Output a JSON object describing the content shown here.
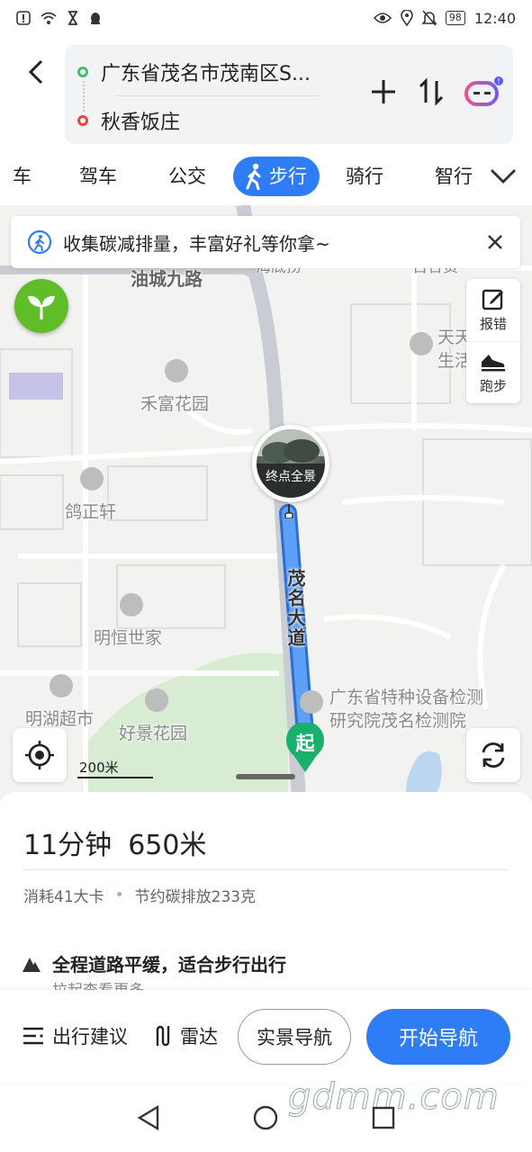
{
  "status_bar": {
    "time": "12:40",
    "battery": "98"
  },
  "route": {
    "origin": "广东省茂名市茂南区S...",
    "destination": "秋香饭庄"
  },
  "tabs": [
    {
      "label": "车"
    },
    {
      "label": "驾车"
    },
    {
      "label": "公交"
    },
    {
      "label": "步行",
      "active": true
    },
    {
      "label": "骑行"
    },
    {
      "label": "智行"
    }
  ],
  "banner": {
    "text": "收集碳减排量，丰富好礼等你拿~"
  },
  "side_tools": {
    "report_label": "报错",
    "run_label": "跑步"
  },
  "map": {
    "labels": {
      "road_top": "油城九路",
      "hefu": "禾富花园",
      "gezheng": "鸽正轩",
      "mingheng": "明恒世家",
      "minghu": "明湖超市",
      "haojing": "好景花园",
      "tianyi_1": "天天",
      "tianyi_2": "生活",
      "main_road": "茂名大道",
      "institute_1": "广东省特种设备检测",
      "institute_2": "研究院茂名检测院",
      "top_fragment_left": "海底捞",
      "top_fragment_right": "百合货"
    },
    "pano_label": "终点全景",
    "start_label": "起",
    "scale": "200米"
  },
  "summary": {
    "duration": "11分钟",
    "distance": "650米",
    "calories": "消耗41大卡",
    "carbon": "节约碳排放233克"
  },
  "tip": {
    "title": "全程道路平缓，适合步行出行",
    "subtitle": "拉起查看更多"
  },
  "actions": {
    "advice_label": "出行建议",
    "radar_label": "雷达",
    "ar_nav_label": "实景导航",
    "start_nav_label": "开始导航"
  },
  "watermark": "gdmm.com",
  "colors": {
    "primary": "#2f7df6",
    "route": "#4a90f0",
    "green": "#5fbd2a",
    "start_pin": "#19b06b"
  }
}
